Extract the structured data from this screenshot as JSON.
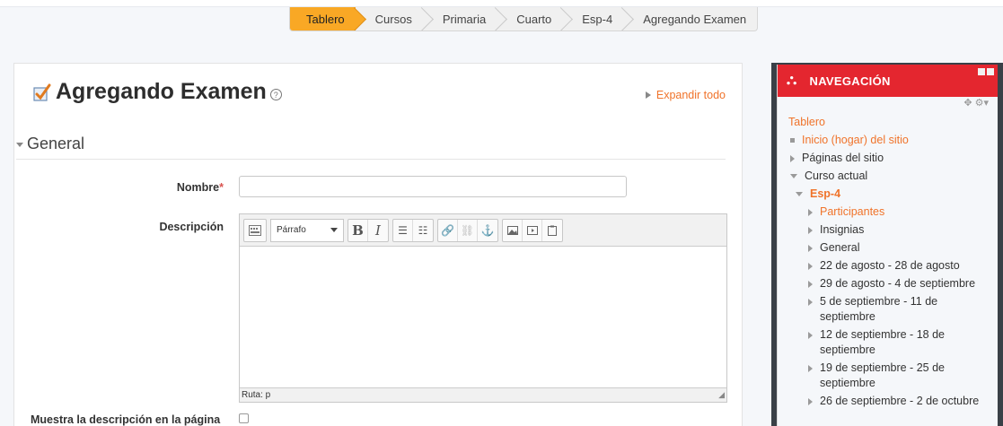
{
  "breadcrumb": [
    "Tablero",
    "Cursos",
    "Primaria",
    "Cuarto",
    "Esp-4",
    "Agregando Examen"
  ],
  "page": {
    "title": "Agregando Examen",
    "expand_all": "Expandir todo",
    "section": "General"
  },
  "form": {
    "name_label": "Nombre",
    "name_required": "*",
    "name_value": "",
    "description_label": "Descripción",
    "format_select": "Párrafo",
    "path_label": "Ruta: p",
    "show_description_label": "Muestra la descripción en la página"
  },
  "nav": {
    "title": "NAVEGACIÓN",
    "items": [
      {
        "label": "Tablero",
        "style": "orange",
        "indent": 0,
        "marker": "none"
      },
      {
        "label": "Inicio (hogar) del sitio",
        "style": "orange",
        "indent": 1,
        "marker": "bullet"
      },
      {
        "label": "Páginas del sitio",
        "style": "",
        "indent": 1,
        "marker": "right"
      },
      {
        "label": "Curso actual",
        "style": "",
        "indent": 1,
        "marker": "down"
      },
      {
        "label": "Esp-4",
        "style": "orange bold",
        "indent": 2,
        "marker": "down"
      },
      {
        "label": "Participantes",
        "style": "orange",
        "indent": 3,
        "marker": "right"
      },
      {
        "label": "Insignias",
        "style": "",
        "indent": 3,
        "marker": "right"
      },
      {
        "label": "General",
        "style": "",
        "indent": 3,
        "marker": "right"
      },
      {
        "label": "22 de agosto - 28 de agosto",
        "style": "",
        "indent": 3,
        "marker": "right"
      },
      {
        "label": "29 de agosto - 4 de septiembre",
        "style": "",
        "indent": 3,
        "marker": "right"
      },
      {
        "label": "5 de septiembre - 11 de septiembre",
        "style": "",
        "indent": 3,
        "marker": "right"
      },
      {
        "label": "12 de septiembre - 18 de septiembre",
        "style": "",
        "indent": 3,
        "marker": "right"
      },
      {
        "label": "19 de septiembre - 25 de septiembre",
        "style": "",
        "indent": 3,
        "marker": "right"
      },
      {
        "label": "26 de septiembre - 2 de octubre",
        "style": "",
        "indent": 3,
        "marker": "right"
      }
    ]
  }
}
